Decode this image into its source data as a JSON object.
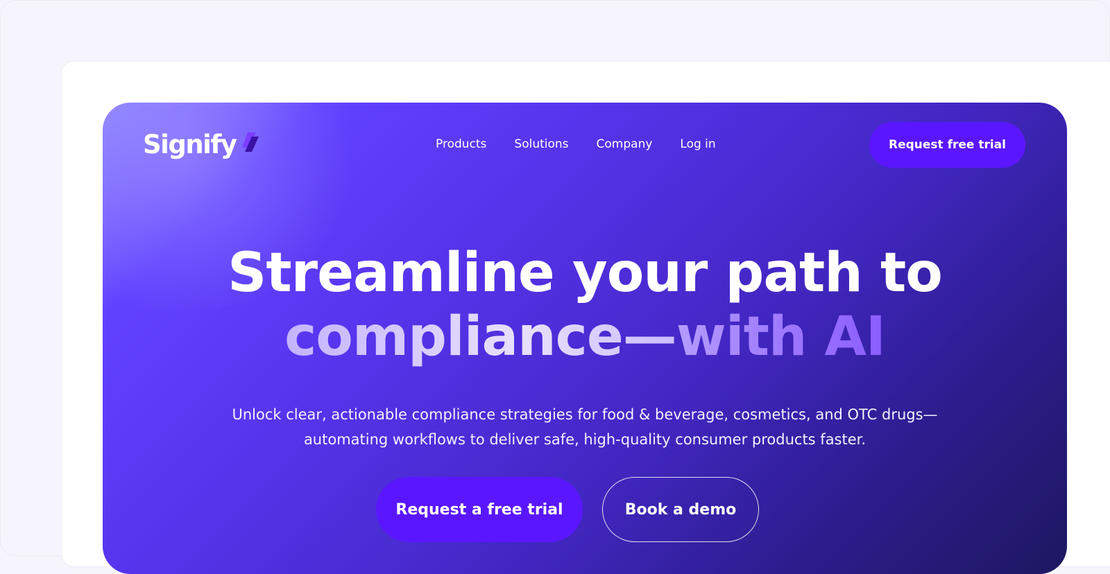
{
  "brand": {
    "name": "Signify",
    "accent": "#5a17ff",
    "logo_mark": "slanted-double-bar-icon"
  },
  "nav": {
    "items": [
      {
        "label": "Products"
      },
      {
        "label": "Solutions"
      },
      {
        "label": "Company"
      },
      {
        "label": "Log in"
      }
    ],
    "cta_label": "Request free trial"
  },
  "hero": {
    "headline_line1": "Streamline your path to",
    "headline_line2_a": "compliance—",
    "headline_line2_b": "with AI",
    "subtext": "Unlock clear, actionable compliance strategies for food & beverage, cosmetics, and OTC drugs—automating workflows to deliver safe, high-quality consumer products faster.",
    "primary_cta": "Request a free trial",
    "secondary_cta": "Book a demo",
    "gradient_colors": [
      "#8c82ff",
      "#5634ec",
      "#1d1760"
    ]
  }
}
